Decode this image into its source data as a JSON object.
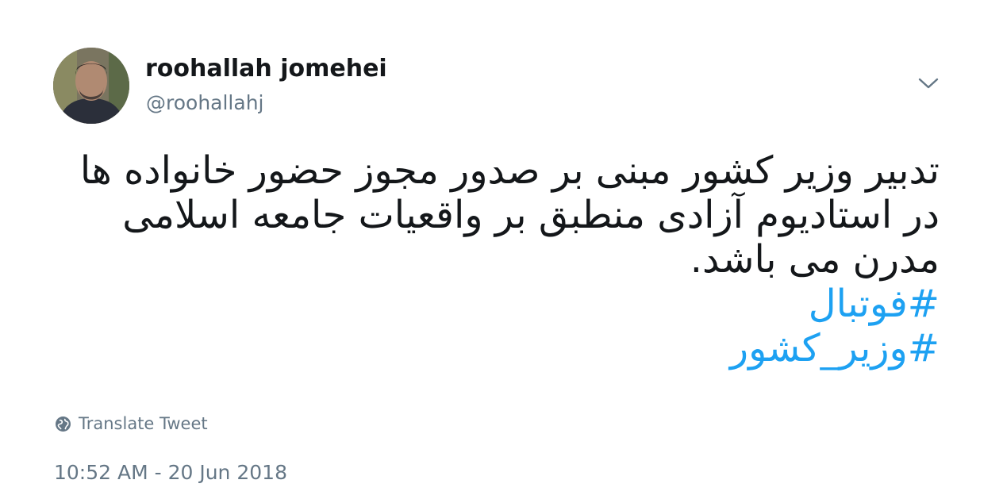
{
  "tweet": {
    "author": {
      "display_name": "roohallah jomehei",
      "handle": "@roohallahj"
    },
    "text": "تدبیر وزیر کشور مبنی بر صدور مجوز حضور خانواده ها در استادیوم آزادی منطبق بر واقعیات جامعه اسلامی مدرن می باشد.",
    "hashtags": [
      "#فوتبال",
      "#وزیر_کشور"
    ],
    "translate_label": "Translate Tweet",
    "timestamp": "10:52 AM - 20 Jun 2018",
    "icons": {
      "avatar": "profile-photo",
      "menu": "chevron-down-icon",
      "translate": "globe-icon"
    },
    "colors": {
      "text": "#14171a",
      "secondary": "#657786",
      "link": "#1da1f2"
    }
  }
}
